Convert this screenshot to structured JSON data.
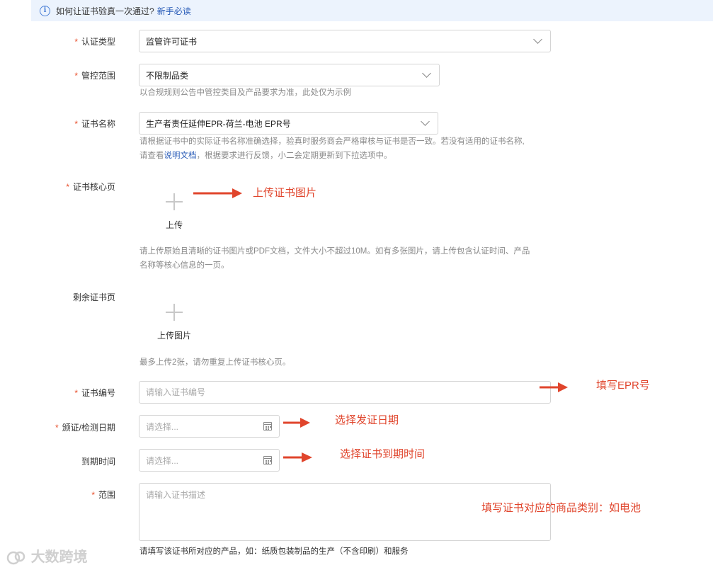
{
  "tip": {
    "text": "如何让证书验真一次通过?",
    "link": "新手必读"
  },
  "form": {
    "cert_type": {
      "label": "认证类型",
      "value": "监管许可证书"
    },
    "scope_control": {
      "label": "管控范围",
      "value": "不限制品类",
      "hint": "以合规规则公告中管控类目及产品要求为准，此处仅为示例"
    },
    "cert_name": {
      "label": "证书名称",
      "value": "生产者责任延伸EPR-荷兰-电池 EPR号",
      "hint_line1": "请根据证书中的实际证书名称准确选择，验真时服务商会严格审核与证书是否一致。若没有适用的证书名称,",
      "hint_line2_pre": "请查看",
      "hint_link": "说明文档",
      "hint_line2_post": "，根据要求进行反馈，小二会定期更新到下拉选项中。"
    },
    "core_page": {
      "label": "证书核心页",
      "upload_label": "上传",
      "hint_line1": "请上传原始且清晰的证书图片或PDF文档，文件大小不超过10M。如有多张图片，请上传包含认证时间、产品",
      "hint_line2": "名称等核心信息的一页。"
    },
    "other_pages": {
      "label": "剩余证书页",
      "upload_label": "上传图片",
      "hint": "最多上传2张，请勿重复上传证书核心页。"
    },
    "cert_number": {
      "label": "证书编号",
      "placeholder": "请输入证书编号"
    },
    "issue_date": {
      "label": "颁证/检测日期",
      "placeholder": "请选择..."
    },
    "expiry_date": {
      "label": "到期时间",
      "placeholder": "请选择..."
    },
    "scope": {
      "label": "范围",
      "placeholder": "请输入证书描述",
      "hint": "请填写该证书所对应的产品，如：纸质包装制品的生产（不含印刷）和服务"
    }
  },
  "annotations": {
    "upload": "上传证书图片",
    "epr": "填写EPR号",
    "issue": "选择发证日期",
    "expiry": "选择证书到期时间",
    "scope": "填写证书对应的商品类别：如电池"
  },
  "watermark": "大数跨境",
  "colors": {
    "accent_link": "#2a5cb8",
    "required_star": "#e8502c",
    "annotation": "#e0452c",
    "tip_bg": "#ecf3fd"
  }
}
